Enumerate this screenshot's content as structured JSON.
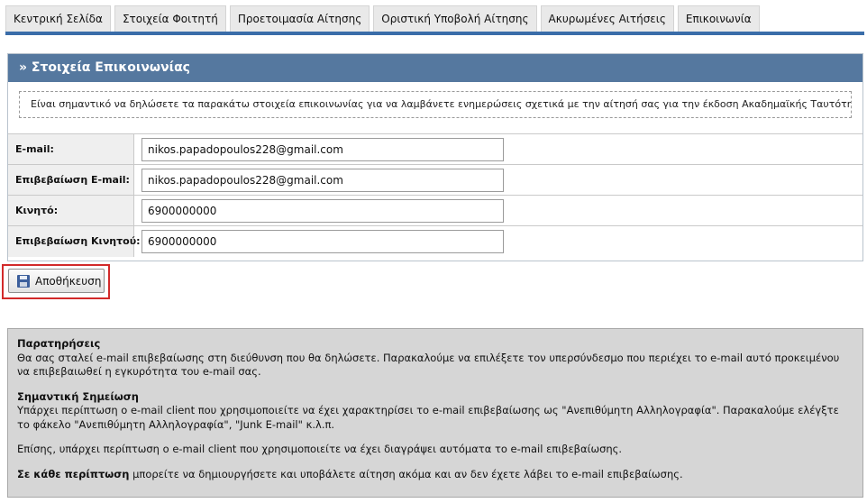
{
  "tabs": [
    {
      "label": "Κεντρική Σελίδα"
    },
    {
      "label": "Στοιχεία Φοιτητή"
    },
    {
      "label": "Προετοιμασία Αίτησης"
    },
    {
      "label": "Οριστική Υποβολή Αίτησης"
    },
    {
      "label": "Ακυρωμένες Αιτήσεις"
    },
    {
      "label": "Επικοινωνία"
    }
  ],
  "panel": {
    "title": "» Στοιχεία Επικοινωνίας",
    "intro": "Είναι σημαντικό να δηλώσετε τα παρακάτω στοιχεία επικοινωνίας για να λαμβάνετε ενημερώσεις σχετικά με την αίτησή σας για την έκδοση Ακαδημαϊκής Ταυτότητας",
    "fields": [
      {
        "label": "E-mail:",
        "value": "nikos.papadopoulos228@gmail.com"
      },
      {
        "label": "Επιβεβαίωση E-mail:",
        "value": "nikos.papadopoulos228@gmail.com"
      },
      {
        "label": "Κινητό:",
        "value": "6900000000"
      },
      {
        "label": "Επιβεβαίωση Κινητού:",
        "value": "6900000000"
      }
    ]
  },
  "save_button": {
    "label": "Αποθήκευση",
    "icon": "floppy-disk-icon",
    "highlight_color": "#d22a2a"
  },
  "notes": {
    "remarks_heading": "Παρατηρήσεις",
    "remarks_text": "Θα σας σταλεί e-mail επιβεβαίωσης στη διεύθυνση που θα δηλώσετε. Παρακαλούμε να επιλέξετε τον υπερσύνδεσμο που περιέχει το e-mail αυτό προκειμένου να επιβεβαιωθεί η εγκυρότητα του e-mail σας.",
    "important_heading": "Σημαντική Σημείωση",
    "important_text": "Υπάρχει περίπτωση ο e-mail client που χρησιμοποιείτε να έχει χαρακτηρίσει το e-mail επιβεβαίωσης ως \"Ανεπιθύμητη Αλληλογραφία\". Παρακαλούμε ελέγξτε το φάκελο \"Ανεπιθύμητη Αλληλογραφία\", \"Junk E-mail\" κ.λ.π.",
    "deleted_text": "Επίσης, υπάρχει περίπτωση ο e-mail client που χρησιμοποιείτε να έχει διαγράψει αυτόματα το e-mail επιβεβαίωσης.",
    "final_bold": "Σε κάθε περίπτωση",
    "final_text": " μπορείτε να δημιουργήσετε και υποβάλετε αίτηση ακόμα και αν δεν έχετε λάβει το e-mail επιβεβαίωσης."
  },
  "colors": {
    "tab_rule": "#3a6da9",
    "panel_header": "#55789f",
    "notes_bg": "#d6d6d6"
  }
}
